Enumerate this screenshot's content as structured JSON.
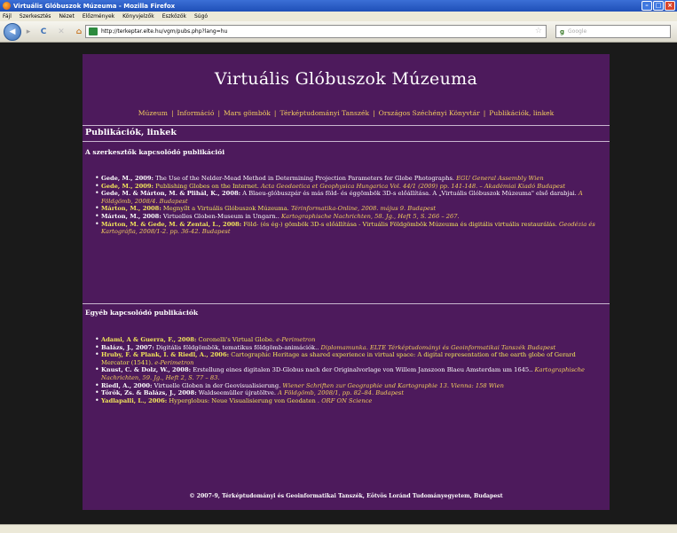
{
  "browser": {
    "window_title": "Virtuális Glóbuszok Múzeuma - Mozilla Firefox",
    "menu": [
      "Fájl",
      "Szerkesztés",
      "Nézet",
      "Előzmények",
      "Könyvjelzők",
      "Eszközök",
      "Súgó"
    ],
    "url": "http://terkeptar.elte.hu/vgm/pubs.php?lang=hu",
    "search_placeholder": "Google"
  },
  "site": {
    "title": "Virtuális Glóbuszok Múzeuma",
    "nav": [
      "Múzeum",
      "Információ",
      "Mars gömbök",
      "Térképtudományi Tanszék",
      "Országos Széchényi Könyvtár",
      "Publikációk, linkek"
    ],
    "page_title": "Publikációk, linkek",
    "section1": {
      "heading": "A szerkesztők kapcsolódó publikációi",
      "items": [
        {
          "author": "Gede, M., 2009:",
          "text": " The Use of the Nelder-Mead Method in Determining Projection Parameters for Globe Photographs.",
          "venue": " EGU General Assembly Wien",
          "hl": false
        },
        {
          "author": "Gede, M., 2009:",
          "text": " Publishing Globes on the Internet.",
          "venue": " Acta Geodaetica et Geophysica Hungarica Vol. 44/1 (2009) pp. 141-148. – Akadémiai Kiadó Budapest",
          "hl": true
        },
        {
          "author": "Gede, M. & Márton, M. & Plihál, K., 2008:",
          "text": " A Blaeu-glóbuszpár és más föld- és éggömbök 3D-s előállítása. A „Virtuális Glóbuszok Múzeuma\" első darabjai.",
          "venue": " A Földgömb, 2008/4. Budapest",
          "hl": false
        },
        {
          "author": "Márton, M., 2008:",
          "text": " Megnyílt a Virtuális Glóbuszok Múzeuma.",
          "venue": " Térinformatika-Online, 2008. május 9. Budapest",
          "hl": true
        },
        {
          "author": "Márton, M., 2008:",
          "text": " Virtuelles Globen-Museum in Ungarn..",
          "venue": " Kartographische Nachrichten, 58. Jg., Heft 5, S. 266 – 267.",
          "hl": false
        },
        {
          "author": "Márton, M. & Gede, M. & Zentai, L., 2008:",
          "text": " Föld- (és ég-) gömbök 3D-s előállítása - Virtuális Földgömbök Múzeuma és digitális virtuális restaurálás.",
          "venue": " Geodézia és Kartográfia, 2008/1-2. pp. 36-42. Budapest",
          "hl": true
        }
      ]
    },
    "section2": {
      "heading": "Egyéb kapcsolódó publikációk",
      "items": [
        {
          "author": "Adami, A & Guerra, F., 2008:",
          "text": " Coronelli's Virtual Globe.",
          "venue": " e-Perimetron",
          "hl": true
        },
        {
          "author": "Balázs, J., 2007:",
          "text": " Digitális földgömbök, tematikus földgömb-animációk..",
          "venue": " Diplomamunka. ELTE Térképtudományi és Geoinformatikai Tanszék Budapest",
          "hl": false
        },
        {
          "author": "Hruby, F. & Plank, I. & Riedl, A., 2006:",
          "text": " Cartographic Heritage as shared experience in virtual space: A digital representation of the earth globe of Gerard Mercator (1541).",
          "venue": " e-Perimetron",
          "hl": true
        },
        {
          "author": "Knust, C. & Dolz, W., 2008:",
          "text": " Erstellung eines digitalen 3D-Globus nach der Originalvorlage von Willem Janszoon Blaeu Amsterdam um 1645..",
          "venue": " Kartographische Nachrichten, 59. Jg., Heft 2, S. 77 – 83.",
          "hl": false
        },
        {
          "author": "Riedl, A., 2000:",
          "text": " Virtuelle Globen in der Geovisualisierung.",
          "venue": " Wiener Schriften zur Geographie und Kartographie 13. Vienna: 158 Wien",
          "hl": false
        },
        {
          "author": "Török, Zs. & Balázs, J., 2008:",
          "text": " Waldseemüller újratöltve.",
          "venue": " A Földgömb, 2008/1, pp. 82–84. Budapest",
          "hl": false
        },
        {
          "author": "Yadlapalli, L., 2006:",
          "text": " Hyperglobus: Neue Visualisierung von Geodaten .",
          "venue": " ORF ON Science",
          "hl": true
        }
      ]
    },
    "footer": "© 2007-9, Térképtudományi és Geoinformatikai Tanszék, Eötvös Loránd Tudományegyetem, Budapest"
  }
}
